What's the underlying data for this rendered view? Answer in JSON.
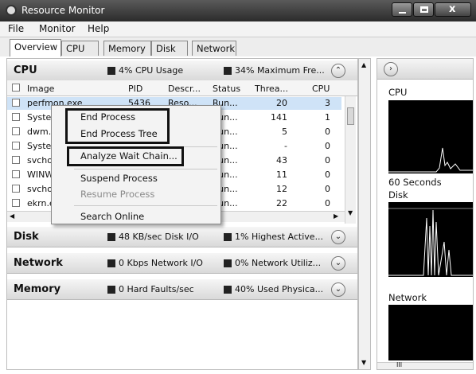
{
  "window": {
    "title": "Resource Monitor"
  },
  "menu": [
    "File",
    "Monitor",
    "Help"
  ],
  "tabs": [
    "Overview",
    "CPU",
    "Memory",
    "Disk",
    "Network"
  ],
  "cpu_section": {
    "title": "CPU",
    "usage": "4% CPU Usage",
    "max_freq": "34% Maximum Fre...",
    "columns": [
      "Image",
      "PID",
      "Descr...",
      "Status",
      "Threa...",
      "CPU"
    ],
    "rows": [
      {
        "image": "perfmon.exe",
        "pid": "5436",
        "desc": "Reso...",
        "status": "Run...",
        "threads": "20",
        "cpu": "3"
      },
      {
        "image": "System",
        "pid": "",
        "desc": "",
        "status": "Run...",
        "threads": "141",
        "cpu": "1"
      },
      {
        "image": "dwm.exe",
        "pid": "",
        "desc": "",
        "status": "Run...",
        "threads": "5",
        "cpu": "0"
      },
      {
        "image": "System",
        "pid": "",
        "desc": "",
        "status": "Run...",
        "threads": "-",
        "cpu": "0"
      },
      {
        "image": "svchost.exe",
        "pid": "",
        "desc": "",
        "status": "Run...",
        "threads": "43",
        "cpu": "0"
      },
      {
        "image": "WINWORD.EXE",
        "pid": "",
        "desc": "",
        "status": "Run...",
        "threads": "11",
        "cpu": "0"
      },
      {
        "image": "svchost.exe",
        "pid": "",
        "desc": "",
        "status": "Run...",
        "threads": "12",
        "cpu": "0"
      },
      {
        "image": "ekrn.exe",
        "pid": "",
        "desc": "",
        "status": "Run...",
        "threads": "22",
        "cpu": "0"
      }
    ]
  },
  "context_menu": {
    "items": [
      "End Process",
      "End Process Tree",
      "Analyze Wait Chain...",
      "Suspend Process",
      "Resume Process",
      "Search Online"
    ]
  },
  "disk_section": {
    "title": "Disk",
    "io": "48 KB/sec Disk I/O",
    "active": "1% Highest Active..."
  },
  "network_section": {
    "title": "Network",
    "io": "0 Kbps Network I/O",
    "util": "0% Network Utiliz..."
  },
  "memory_section": {
    "title": "Memory",
    "faults": "0 Hard Faults/sec",
    "used": "40% Used Physica..."
  },
  "right_pane": {
    "cpu_label": "CPU",
    "time_label": "60 Seconds",
    "disk_label": "Disk",
    "network_label": "Network",
    "scroll_label": "III"
  }
}
